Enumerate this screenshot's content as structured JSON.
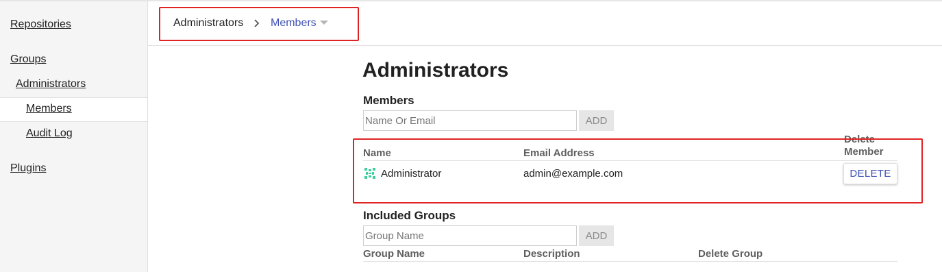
{
  "sidebar": {
    "repositories": "Repositories",
    "groups": "Groups",
    "administrators": "Administrators",
    "members": "Members",
    "audit_log": "Audit Log",
    "plugins": "Plugins"
  },
  "breadcrumb": {
    "parent": "Administrators",
    "current": "Members",
    "current_color": "#3f51b5"
  },
  "main": {
    "title": "Administrators",
    "members": {
      "heading": "Members",
      "input_placeholder": "Name Or Email",
      "input_value": "",
      "add_label": "ADD",
      "columns": {
        "name": "Name",
        "email": "Email Address",
        "delete_line1": "Delete",
        "delete_line2": "Member"
      },
      "rows": [
        {
          "name": "Administrator",
          "email": "admin@example.com",
          "delete_label": "DELETE",
          "avatar_icon": "identicon-icon"
        }
      ]
    },
    "included_groups": {
      "heading": "Included Groups",
      "input_placeholder": "Group Name",
      "input_value": "",
      "add_label": "ADD",
      "columns": {
        "name": "Group Name",
        "description": "Description",
        "delete": "Delete Group"
      }
    }
  },
  "colors": {
    "highlight": "#e02222",
    "accent": "#3f51b5",
    "avatar": "#3ecf9e"
  }
}
